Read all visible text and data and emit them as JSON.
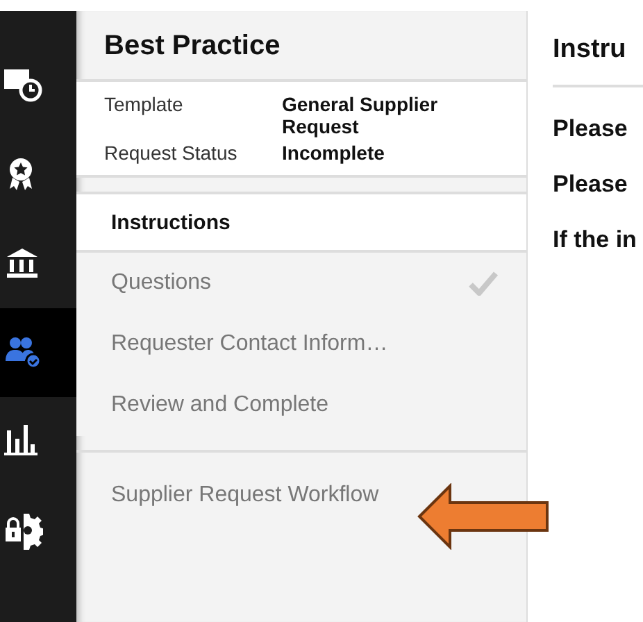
{
  "rail": {
    "items": [
      {
        "selected": false
      },
      {
        "selected": false
      },
      {
        "selected": false
      },
      {
        "selected": true
      },
      {
        "selected": false
      },
      {
        "selected": false
      }
    ]
  },
  "panel": {
    "title": "Best Practice",
    "details": [
      {
        "label": "Template",
        "value": "General Supplier Request"
      },
      {
        "label": "Request Status",
        "value": "Incomplete"
      }
    ],
    "steps": [
      {
        "label": "Instructions",
        "selected": true,
        "completed": false
      },
      {
        "label": "Questions",
        "selected": false,
        "completed": true
      },
      {
        "label": "Requester Contact Inform…",
        "selected": false,
        "completed": false
      },
      {
        "label": "Review and Complete",
        "selected": false,
        "completed": false
      }
    ],
    "workflow": {
      "label": "Supplier Request Workflow"
    }
  },
  "content": {
    "title": "Instru",
    "lines": [
      "Please",
      "Please",
      "If the in"
    ]
  }
}
